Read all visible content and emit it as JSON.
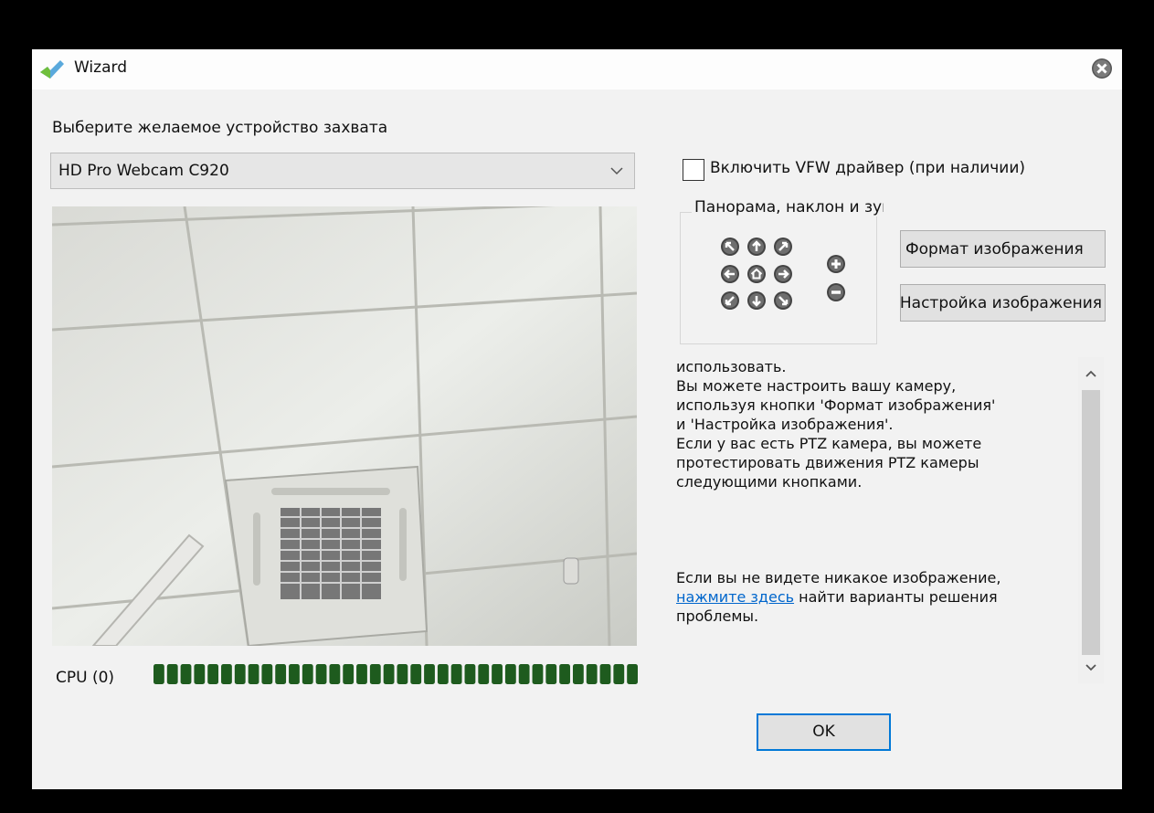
{
  "window": {
    "title": "Wizard"
  },
  "device": {
    "label": "Выберите желаемое устройство захвата",
    "selected": "HD Pro Webcam C920"
  },
  "cpu": {
    "label": "CPU (0)",
    "segments": 36
  },
  "vfw": {
    "label": "Включить VFW драйвер (при наличии)",
    "checked": false
  },
  "ptz": {
    "legend": "Панорама, наклон и зум"
  },
  "buttons": {
    "format": "Формат изображения",
    "settings": "Настройка изображения",
    "ok": "OK"
  },
  "help": {
    "lines": [
      "использовать.",
      "Вы можете настроить вашу камеру,",
      "используя кнопки 'Формат изображения'",
      "и 'Настройка изображения'.",
      "Если у вас есть PTZ камера, вы можете",
      "протестировать  движения PTZ камеры",
      "следующими кнопками."
    ],
    "trouble_prefix": "Если вы не видете никакое изображение,",
    "link": "нажмите здесь",
    "trouble_suffix": " найти варианты решения",
    "trouble_end": "проблемы."
  },
  "colors": {
    "cpu_segment": "#1e5b1e",
    "ok_border": "#0078d7",
    "link": "#0066cc"
  }
}
